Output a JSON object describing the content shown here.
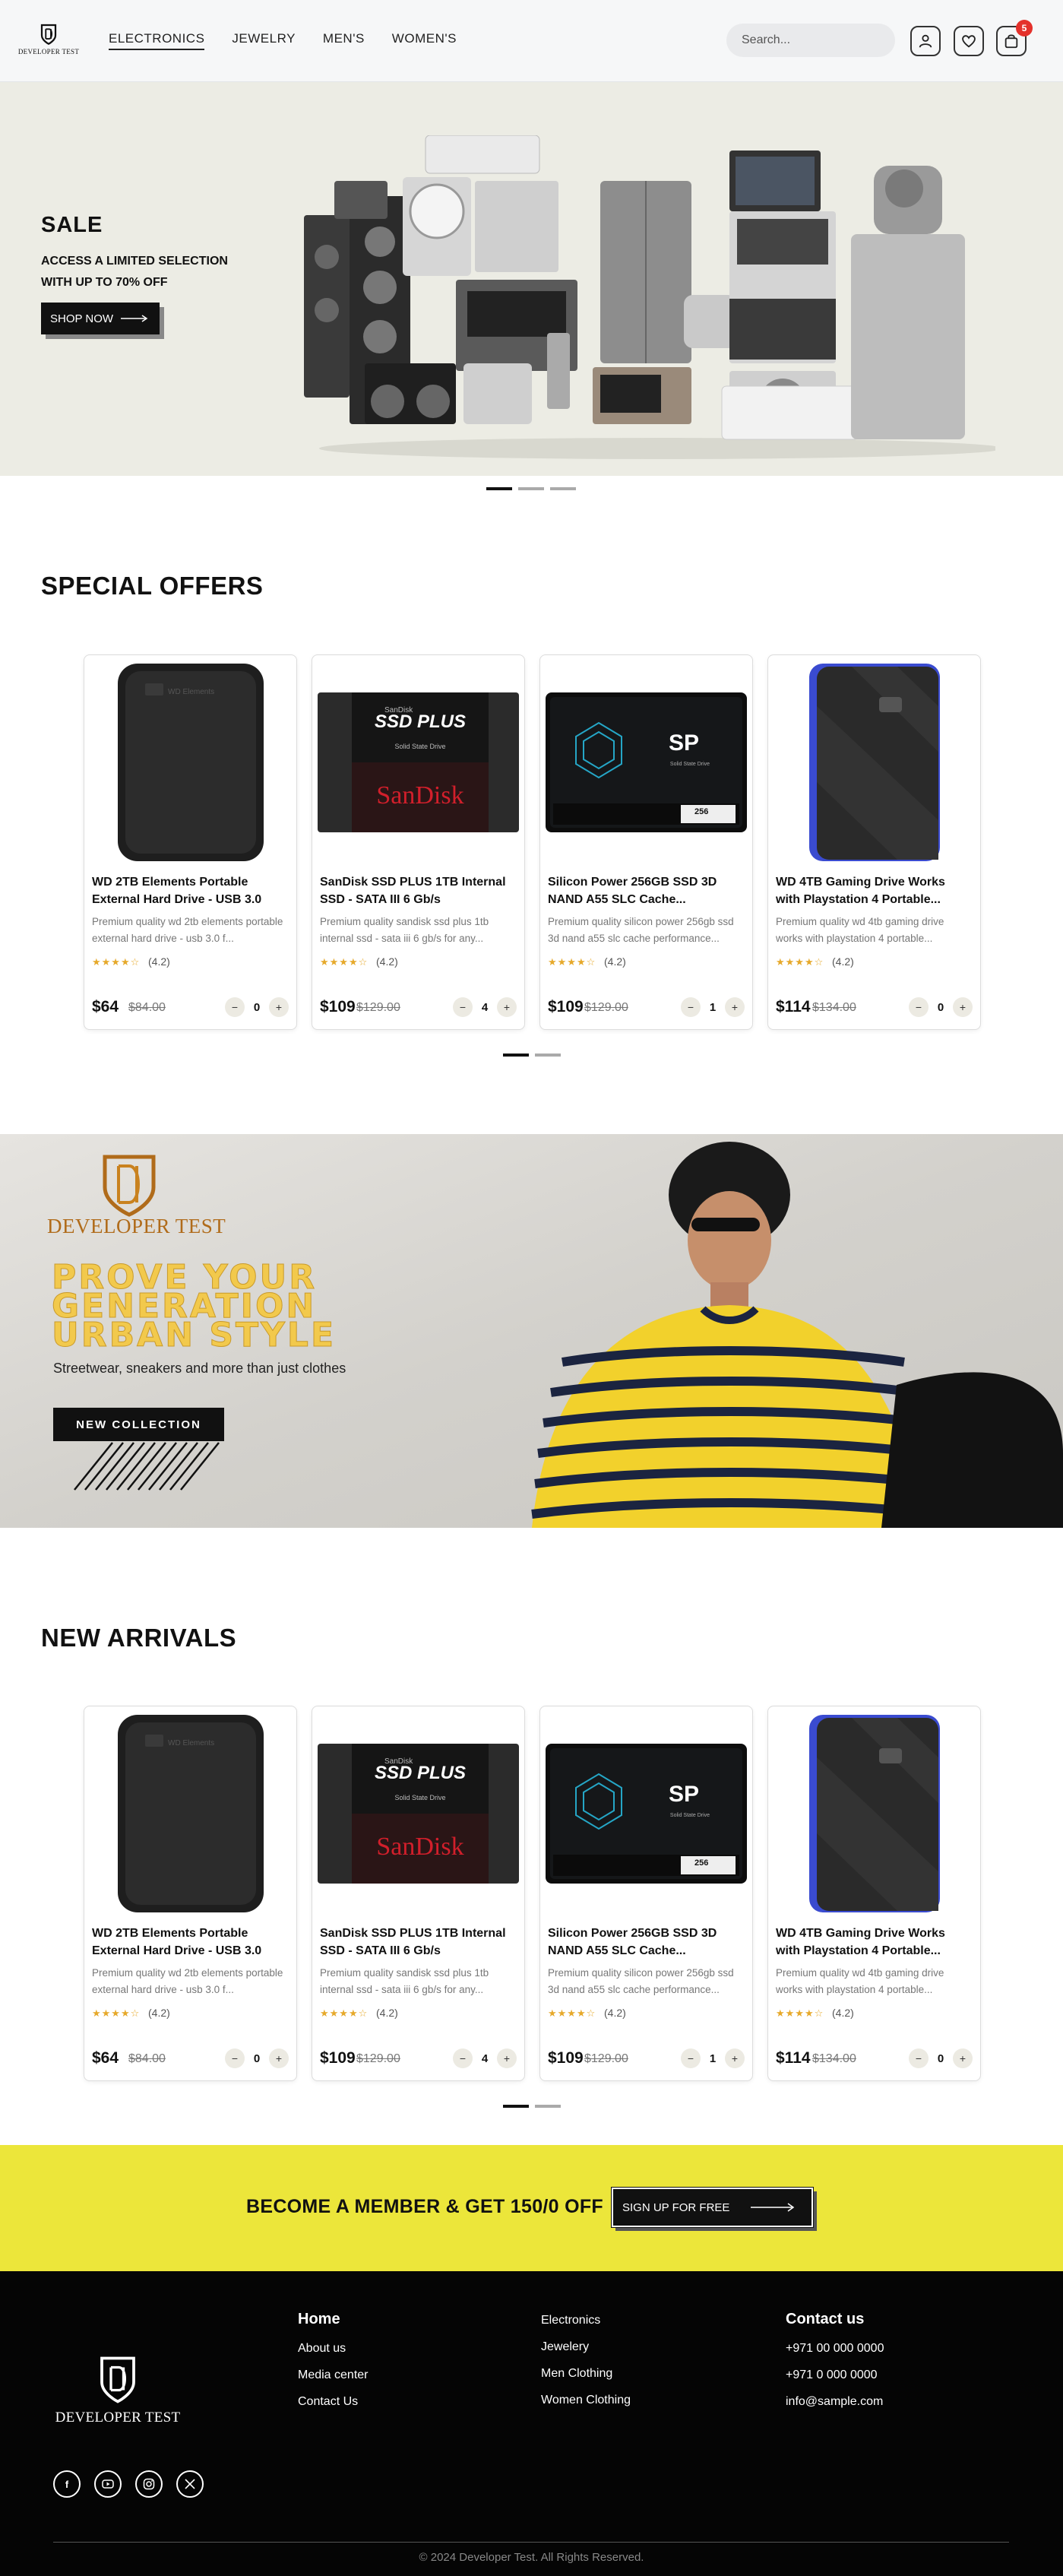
{
  "header": {
    "logo_text": "DEVELOPER TEST",
    "nav": [
      "ELECTRONICS",
      "JEWELRY",
      "MEN'S",
      "WOMEN'S"
    ],
    "search_placeholder": "Search...",
    "cart_count": "5"
  },
  "hero": {
    "title": "SALE",
    "subtitle_line1": "ACCESS A LIMITED SELECTION",
    "subtitle_line2": "WITH UP TO 70% OFF",
    "button": "SHOP NOW"
  },
  "special_offers": {
    "title": "SPECIAL OFFERS",
    "products": [
      {
        "name": "WD 2TB Elements Portable External Hard Drive - USB 3.0",
        "desc": "Premium quality wd 2tb elements portable external hard drive - usb 3.0 f...",
        "stars": "★★★★☆",
        "rating": "(4.2)",
        "price": "$64",
        "old_price": "$84.00",
        "qty": "0",
        "img": "hdd-black"
      },
      {
        "name": "SanDisk SSD PLUS 1TB Internal SSD - SATA III 6 Gb/s",
        "desc": "Premium quality sandisk ssd plus 1tb internal ssd - sata iii 6 gb/s for any...",
        "stars": "★★★★☆",
        "rating": "(4.2)",
        "price": "$109",
        "old_price": "$129.00",
        "qty": "4",
        "img": "sandisk-ssd"
      },
      {
        "name": "Silicon Power 256GB SSD 3D NAND A55 SLC Cache...",
        "desc": "Premium quality silicon power 256gb ssd 3d nand a55 slc cache performance...",
        "stars": "★★★★☆",
        "rating": "(4.2)",
        "price": "$109",
        "old_price": "$129.00",
        "qty": "1",
        "img": "sp-ssd"
      },
      {
        "name": "WD 4TB Gaming Drive Works with Playstation 4 Portable...",
        "desc": "Premium quality wd 4tb gaming drive works with playstation 4 portable...",
        "stars": "★★★★☆",
        "rating": "(4.2)",
        "price": "$114",
        "old_price": "$134.00",
        "qty": "0",
        "img": "hdd-blue"
      }
    ]
  },
  "promo": {
    "logo_text": "DEVELOPER TEST",
    "headline": [
      "PROVE YOUR",
      "GENERATION",
      "URBAN STYLE"
    ],
    "subtitle": "Streetwear, sneakers and more than just clothes",
    "button": "NEW COLLECTION"
  },
  "new_arrivals": {
    "title": "NEW ARRIVALS",
    "products": [
      {
        "name": "WD 2TB Elements Portable External Hard Drive - USB 3.0",
        "desc": "Premium quality wd 2tb elements portable external hard drive - usb 3.0 f...",
        "stars": "★★★★☆",
        "rating": "(4.2)",
        "price": "$64",
        "old_price": "$84.00",
        "qty": "0",
        "img": "hdd-black"
      },
      {
        "name": "SanDisk SSD PLUS 1TB Internal SSD - SATA III 6 Gb/s",
        "desc": "Premium quality sandisk ssd plus 1tb internal ssd - sata iii 6 gb/s for any...",
        "stars": "★★★★☆",
        "rating": "(4.2)",
        "price": "$109",
        "old_price": "$129.00",
        "qty": "4",
        "img": "sandisk-ssd"
      },
      {
        "name": "Silicon Power 256GB SSD 3D NAND A55 SLC Cache...",
        "desc": "Premium quality silicon power 256gb ssd 3d nand a55 slc cache performance...",
        "stars": "★★★★☆",
        "rating": "(4.2)",
        "price": "$109",
        "old_price": "$129.00",
        "qty": "1",
        "img": "sp-ssd"
      },
      {
        "name": "WD 4TB Gaming Drive Works with Playstation 4 Portable...",
        "desc": "Premium quality wd 4tb gaming drive works with playstation 4 portable...",
        "stars": "★★★★☆",
        "rating": "(4.2)",
        "price": "$114",
        "old_price": "$134.00",
        "qty": "0",
        "img": "hdd-blue"
      }
    ]
  },
  "member": {
    "text": "BECOME A MEMBER & GET 150/0 OFF",
    "button": "SIGN UP FOR FREE"
  },
  "footer": {
    "logo_text": "DEVELOPER TEST",
    "col1": {
      "heading": "Home",
      "links": [
        "About us",
        "Media center",
        "Contact Us"
      ]
    },
    "col2": {
      "links": [
        "Electronics",
        "Jewelery",
        "Men Clothing",
        "Women Clothing"
      ]
    },
    "col3": {
      "heading": "Contact us",
      "links": [
        "+971 00 000 0000",
        "+971 0 000 0000",
        "info@sample.com"
      ]
    },
    "socials": [
      "facebook-icon",
      "youtube-icon",
      "instagram-icon",
      "x-icon"
    ],
    "copyright": "© 2024 Developer Test. All Rights Reserved."
  },
  "colors": {
    "accent_yellow": "#ece63a",
    "badge_red": "#e4312b",
    "gold": "#f2c94c"
  }
}
